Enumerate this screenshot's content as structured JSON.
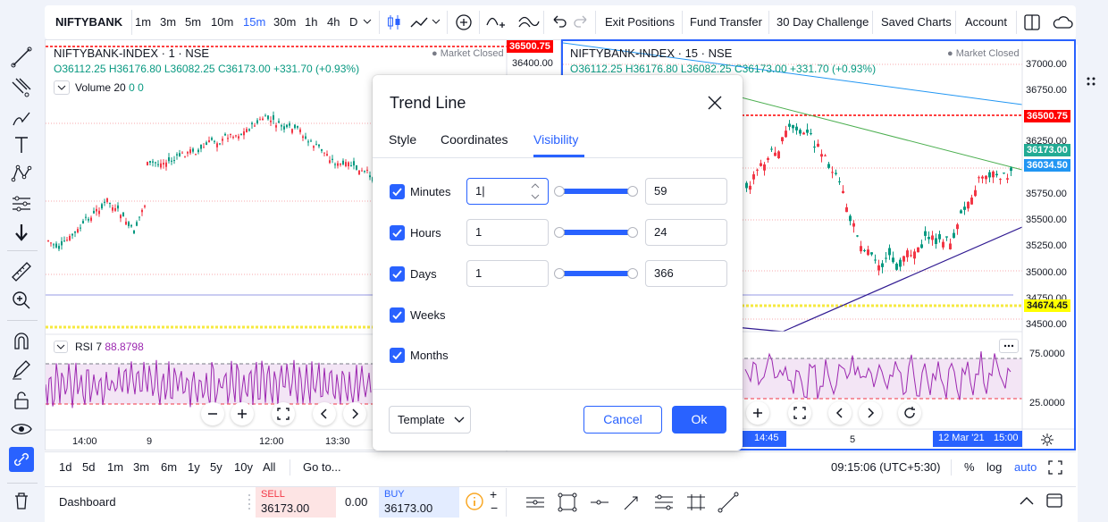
{
  "toolbar": {
    "symbol": "NIFTYBANK",
    "intervals": [
      "1m",
      "3m",
      "5m",
      "10m",
      "15m",
      "30m",
      "1h",
      "4h",
      "D"
    ],
    "active_interval": "15m",
    "buttons": {
      "exit_positions": "Exit Positions",
      "fund_transfer": "Fund Transfer",
      "challenge": "30 Day Challenge",
      "saved_charts": "Saved Charts",
      "account": "Account"
    }
  },
  "left_chart": {
    "title": "NIFTYBANK-INDEX · 1 · NSE",
    "market_status": "Market Closed",
    "ohlc": "O36112.25 H36176.80 L36082.25 C36173.00 +331.70 (+0.93%)",
    "volume": "Volume 20",
    "volume_vals": "0 0",
    "rsi": "RSI 7",
    "rsi_value": "88.8798",
    "price_tag": "36500.75",
    "price_label": "36400.00",
    "time_labels": [
      "14:00",
      "9",
      "12:00",
      "13:30"
    ]
  },
  "right_chart": {
    "title": "NIFTYBANK-INDEX · 15 · NSE",
    "market_status": "Market Closed",
    "ohlc": "O36112.25 H36176.80 L36082.25 C36173.00 +331.70 (+0.93%)",
    "price_labels": [
      "37000.00",
      "36750.00",
      "36250.00",
      "35750.00",
      "35500.00",
      "35250.00",
      "35000.00",
      "34750.00",
      "34500.00"
    ],
    "tags": {
      "red": "36500.75",
      "green": "36173.00",
      "blue": "36034.50",
      "yellow": "34674.45"
    },
    "rsi_labels": [
      "75.0000",
      "25.0000"
    ],
    "time_labels": [
      "14:45",
      "5",
      "12 Mar '21",
      "15:00"
    ]
  },
  "bottom": {
    "ranges": [
      "1d",
      "5d",
      "1m",
      "3m",
      "6m",
      "1y",
      "5y",
      "10y",
      "All"
    ],
    "goto": "Go to...",
    "clock": "09:15:06 (UTC+5:30)",
    "percent": "%",
    "log": "log",
    "auto": "auto"
  },
  "trade": {
    "dashboard": "Dashboard",
    "sell_label": "SELL",
    "sell_price": "36173.00",
    "spread": "0.00",
    "buy_label": "BUY",
    "buy_price": "36173.00"
  },
  "dialog": {
    "title": "Trend Line",
    "tabs": [
      "Style",
      "Coordinates",
      "Visibility"
    ],
    "active_tab": "Visibility",
    "rows": [
      {
        "label": "Minutes",
        "from": "1",
        "to": "59"
      },
      {
        "label": "Hours",
        "from": "1",
        "to": "24"
      },
      {
        "label": "Days",
        "from": "1",
        "to": "366"
      },
      {
        "label": "Weeks"
      },
      {
        "label": "Months"
      }
    ],
    "template": "Template",
    "cancel": "Cancel",
    "ok": "Ok"
  },
  "colors": {
    "accent": "#2962ff",
    "up": "#089981",
    "down": "#f23645",
    "rsi": "#9c27b0",
    "tag_red": "#ff0000",
    "tag_green": "#22ab94",
    "tag_blue": "#2196f3",
    "tag_yellow": "#ffff00"
  }
}
